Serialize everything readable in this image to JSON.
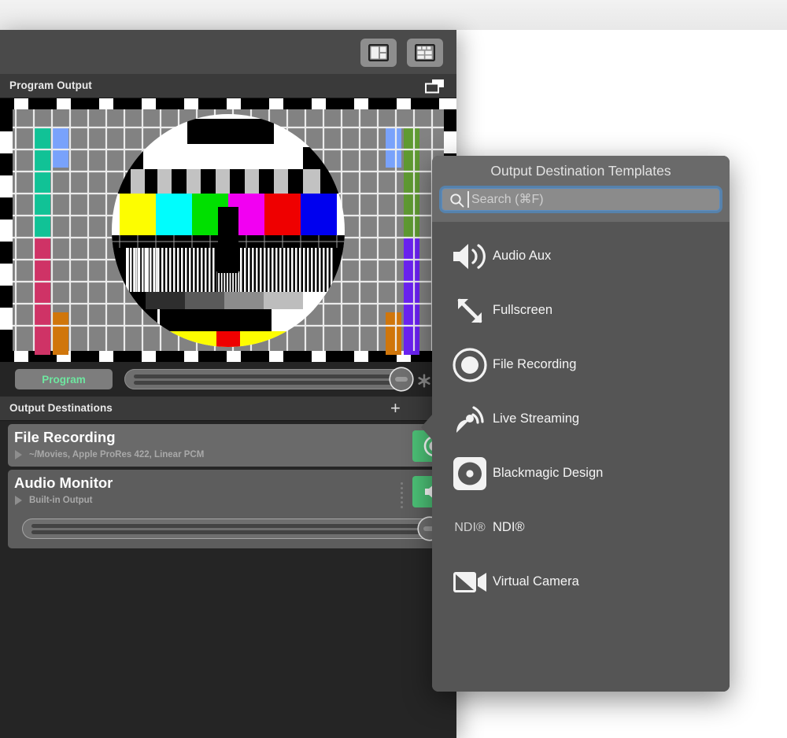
{
  "window": {
    "toolbar": {
      "buttons": [
        {
          "name": "layout-split-view-button",
          "icon": "layout-split-icon"
        },
        {
          "name": "layout-grid-view-button",
          "icon": "layout-grid-icon"
        }
      ]
    }
  },
  "program_panel": {
    "title": "Program Output",
    "popout_icon": "popout-window-icon",
    "chip_label": "Program",
    "slider_value": 100,
    "gear_icon": "gear-icon"
  },
  "destinations_panel": {
    "title": "Output Destinations",
    "add_label": "+",
    "rows": [
      {
        "name": "File Recording",
        "subtitle": "~/Movies, Apple ProRes 422, Linear PCM",
        "action_icon": "record-icon",
        "action_color": "#4cc076"
      },
      {
        "name": "Audio Monitor",
        "subtitle": "Built-in Output",
        "action_icon": "speaker-icon",
        "action_color": "#4cc076",
        "volume": 100
      }
    ]
  },
  "popup": {
    "title": "Output Destination Templates",
    "search": {
      "placeholder": "Search (⌘F)",
      "value": "",
      "icon": "search-icon",
      "focus_color": "#4696e1"
    },
    "items": [
      {
        "label": "Audio Aux",
        "icon": "speaker-waves-icon"
      },
      {
        "label": "Fullscreen",
        "icon": "fullscreen-arrows-icon"
      },
      {
        "label": "File Recording",
        "icon": "record-circle-icon"
      },
      {
        "label": "Live Streaming",
        "icon": "satellite-broadcast-icon"
      },
      {
        "label": "Blackmagic Design",
        "icon": "blackmagic-disc-icon"
      },
      {
        "label": "NDI®",
        "icon": "ndi-wordmark-icon"
      },
      {
        "label": "Virtual Camera",
        "icon": "virtual-camera-icon"
      }
    ]
  },
  "colors": {
    "accent_green": "#4cc076",
    "program_text": "#6ee6a0",
    "focus_blue": "#4696e1",
    "panel_bg": "#252525",
    "popup_bg": "#555555"
  }
}
